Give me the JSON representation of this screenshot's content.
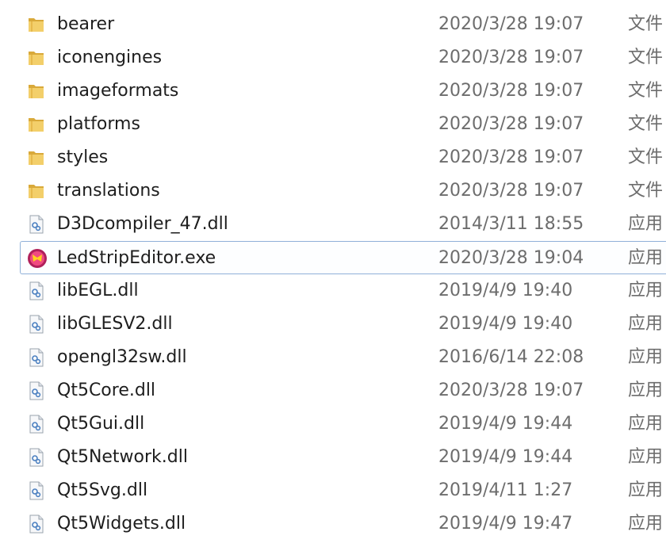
{
  "files": [
    {
      "name": "bearer",
      "date": "2020/3/28 19:07",
      "type": "文件",
      "icon": "folder-icon"
    },
    {
      "name": "iconengines",
      "date": "2020/3/28 19:07",
      "type": "文件",
      "icon": "folder-icon"
    },
    {
      "name": "imageformats",
      "date": "2020/3/28 19:07",
      "type": "文件",
      "icon": "folder-icon"
    },
    {
      "name": "platforms",
      "date": "2020/3/28 19:07",
      "type": "文件",
      "icon": "folder-icon"
    },
    {
      "name": "styles",
      "date": "2020/3/28 19:07",
      "type": "文件",
      "icon": "folder-icon"
    },
    {
      "name": "translations",
      "date": "2020/3/28 19:07",
      "type": "文件",
      "icon": "folder-icon"
    },
    {
      "name": "D3Dcompiler_47.dll",
      "date": "2014/3/11 18:55",
      "type": "应用",
      "icon": "dll-icon"
    },
    {
      "name": "LedStripEditor.exe",
      "date": "2020/3/28 19:04",
      "type": "应用",
      "icon": "app-icon",
      "selected": true
    },
    {
      "name": "libEGL.dll",
      "date": "2019/4/9 19:40",
      "type": "应用",
      "icon": "dll-icon"
    },
    {
      "name": "libGLESV2.dll",
      "date": "2019/4/9 19:40",
      "type": "应用",
      "icon": "dll-icon"
    },
    {
      "name": "opengl32sw.dll",
      "date": "2016/6/14 22:08",
      "type": "应用",
      "icon": "dll-icon"
    },
    {
      "name": "Qt5Core.dll",
      "date": "2020/3/28 19:07",
      "type": "应用",
      "icon": "dll-icon"
    },
    {
      "name": "Qt5Gui.dll",
      "date": "2019/4/9 19:44",
      "type": "应用",
      "icon": "dll-icon"
    },
    {
      "name": "Qt5Network.dll",
      "date": "2019/4/9 19:44",
      "type": "应用",
      "icon": "dll-icon"
    },
    {
      "name": "Qt5Svg.dll",
      "date": "2019/4/11 1:27",
      "type": "应用",
      "icon": "dll-icon"
    },
    {
      "name": "Qt5Widgets.dll",
      "date": "2019/4/9 19:47",
      "type": "应用",
      "icon": "dll-icon"
    }
  ]
}
